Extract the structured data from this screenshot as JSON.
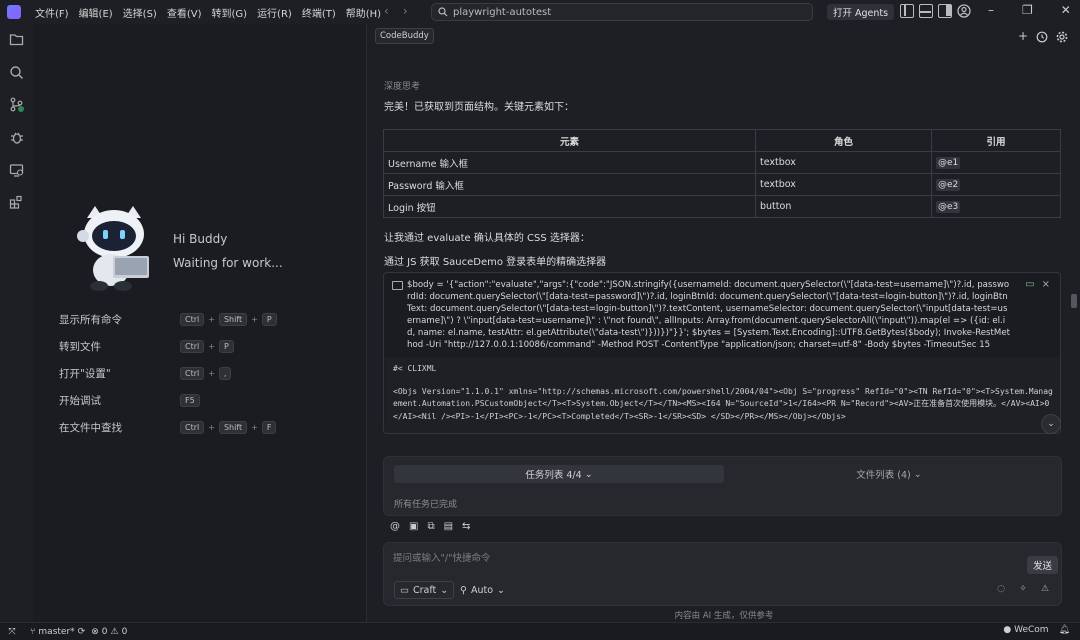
{
  "titlebar": {
    "menu": [
      "文件(F)",
      "编辑(E)",
      "选择(S)",
      "查看(V)",
      "转到(G)",
      "运行(R)",
      "终端(T)",
      "帮助(H)"
    ],
    "search_text": "playwright-autotest",
    "agents_button": "打开 Agents"
  },
  "welcome": {
    "greeting": "Hi Buddy",
    "status": "Waiting for work...",
    "shortcuts": [
      {
        "label": "显示所有命令",
        "keys": [
          "Ctrl",
          "Shift",
          "P"
        ]
      },
      {
        "label": "转到文件",
        "keys": [
          "Ctrl",
          "P"
        ]
      },
      {
        "label": "打开\"设置\"",
        "keys": [
          "Ctrl",
          ","
        ]
      },
      {
        "label": "开始调试",
        "keys": [
          "F5"
        ]
      },
      {
        "label": "在文件中查找",
        "keys": [
          "Ctrl",
          "Shift",
          "F"
        ]
      }
    ]
  },
  "panel": {
    "tab": "CodeBuddy",
    "deep_thinking": "深度思考",
    "para1": "完美！已获取到页面结构。关键元素如下：",
    "table": {
      "headers": [
        "元素",
        "角色",
        "引用"
      ],
      "rows": [
        [
          "Username 输入框",
          "textbox",
          "@e1"
        ],
        [
          "Password 输入框",
          "textbox",
          "@e2"
        ],
        [
          "Login 按钮",
          "button",
          "@e3"
        ]
      ]
    },
    "para2": "让我通过 evaluate 确认具体的 CSS 选择器：",
    "para3": "通过 JS 获取 SauceDemo 登录表单的精确选择器",
    "command": "$body = '{\"action\":\"evaluate\",\"args\":{\"code\":\"JSON.stringify({usernameId: document.querySelector(\\\"[data-test=username]\\\")?.id, passwordId: document.querySelector(\\\"[data-test=password]\\\")?.id, loginBtnId: document.querySelector(\\\"[data-test=login-button]\\\")?.id, loginBtnText: document.querySelector(\\\"[data-test=login-button]\\\")?.textContent, usernameSelector: document.querySelector(\\\"input[data-test=username]\\\") ? \\\"input[data-test=username]\\\" : \\\"not found\\\", allInputs: Array.from(document.querySelectorAll(\\\"input\\\")).map(el => ({id: el.id, name: el.name, testAttr: el.getAttribute(\\\"data-test\\\")}))})\"}}'; $bytes = [System.Text.Encoding]::UTF8.GetBytes($body); Invoke-RestMethod -Uri \"http://127.0.0.1:10086/command\" -Method POST -ContentType \"application/json; charset=utf-8\" -Body $bytes -TimeoutSec 15",
    "output_line1": "#< CLIXML",
    "output_line2": "<Objs Version=\"1.1.0.1\" xmlns=\"http://schemas.microsoft.com/powershell/2004/04\"><Obj S=\"progress\" RefId=\"0\"><TN RefId=\"0\"><T>System.Management.Automation.PSCustomObject</T><T>System.Object</T></TN><MS><I64 N=\"SourceId\">1</I64><PR N=\"Record\"><AV>正在准备首次使用模块。</AV><AI>0</AI><Nil /><PI>-1</PI><PC>-1</PC><T>Completed</T><SR>-1</SR><SD> </SD></PR></MS></Obj></Objs>",
    "task_tab": "任务列表 4/4",
    "file_tab": "文件列表 (4)",
    "task_status": "所有任务已完成",
    "input_placeholder": "提问或输入\"/\"快捷命令",
    "send": "发送",
    "mode": "Craft",
    "auto": "Auto",
    "disclaimer": "内容由 AI 生成，仅供参考"
  },
  "statusbar": {
    "branch": "master*",
    "errors": "0",
    "warnings": "0",
    "right_label": "WeCom"
  }
}
